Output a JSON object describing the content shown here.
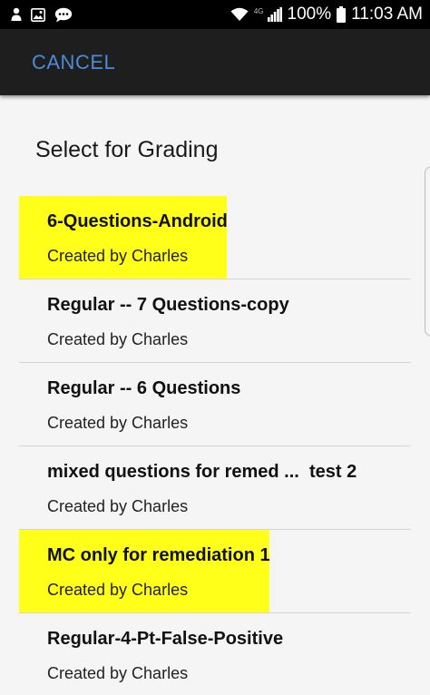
{
  "status_bar": {
    "network_label": "4G",
    "battery": "100%",
    "time": "11:03 AM",
    "icons": {
      "left": [
        "person-icon",
        "image-icon",
        "chat-icon"
      ],
      "right": [
        "wifi-icon",
        "signal-icon",
        "battery-icon"
      ]
    },
    "colors": {
      "background": "#000000",
      "text": "#ffffff"
    }
  },
  "action_bar": {
    "cancel_label": "CANCEL",
    "colors": {
      "background": "#1e1e1e",
      "cancel_text": "#4f8ad6"
    }
  },
  "page": {
    "title": "Select for Grading"
  },
  "list": {
    "highlight_color": "#ffff1a",
    "items": [
      {
        "title": "6-Questions-Android",
        "subtitle": "Created by Charles",
        "highlighted": true
      },
      {
        "title": "Regular -- 7 Questions-copy",
        "subtitle": "Created by Charles",
        "highlighted": false
      },
      {
        "title": "Regular -- 6 Questions",
        "subtitle": "Created by Charles",
        "highlighted": false
      },
      {
        "title": "mixed questions for remed ...  test 2",
        "subtitle": "Created by Charles",
        "highlighted": false
      },
      {
        "title": "MC only for remediation 1",
        "subtitle": "Created by Charles",
        "highlighted": true
      },
      {
        "title": "Regular-4-Pt-False-Positive",
        "subtitle": "Created by Charles",
        "highlighted": false
      }
    ]
  }
}
